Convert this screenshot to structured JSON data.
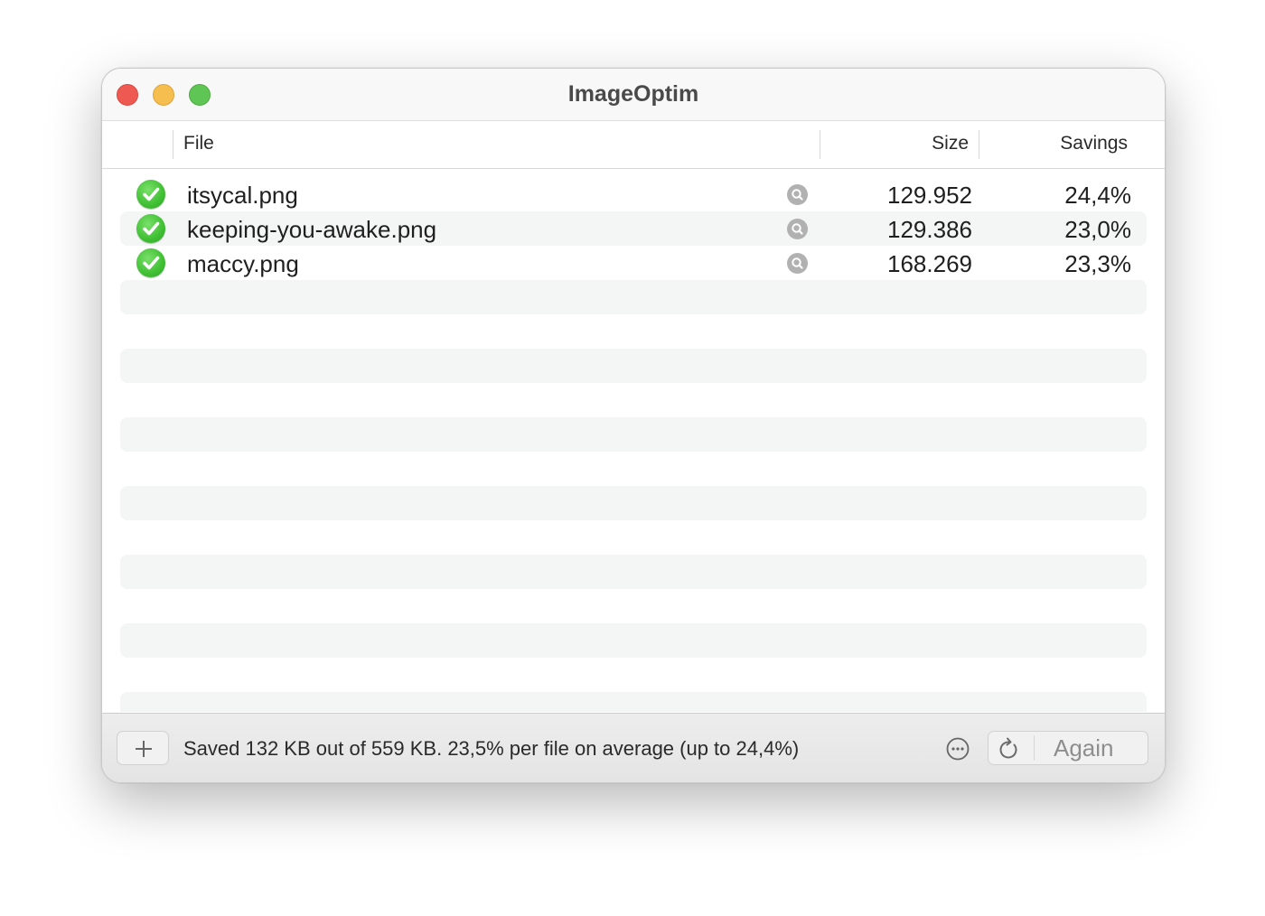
{
  "window": {
    "title": "ImageOptim"
  },
  "columns": {
    "file": "File",
    "size": "Size",
    "savings": "Savings"
  },
  "files": [
    {
      "name": "itsycal.png",
      "size": "129.952",
      "savings": "24,4%",
      "status": "done"
    },
    {
      "name": "keeping-you-awake.png",
      "size": "129.386",
      "savings": "23,0%",
      "status": "done"
    },
    {
      "name": "maccy.png",
      "size": "168.269",
      "savings": "23,3%",
      "status": "done"
    }
  ],
  "footer": {
    "add_label": "+",
    "status_text": "Saved 132 KB out of 559 KB. 23,5% per file on average (up to 24,4%)",
    "again_label": "Again"
  },
  "icons": {
    "close": "close-button",
    "minimize": "minimize-button",
    "maximize": "maximize-button",
    "status": "checkmark-icon",
    "preview": "magnifier-icon",
    "more": "ellipsis-circle-icon",
    "refresh": "refresh-icon"
  },
  "colors": {
    "close": "#ee5a52",
    "minimize": "#f5be4f",
    "maximize": "#5fc554",
    "success": "#3fbf33"
  }
}
